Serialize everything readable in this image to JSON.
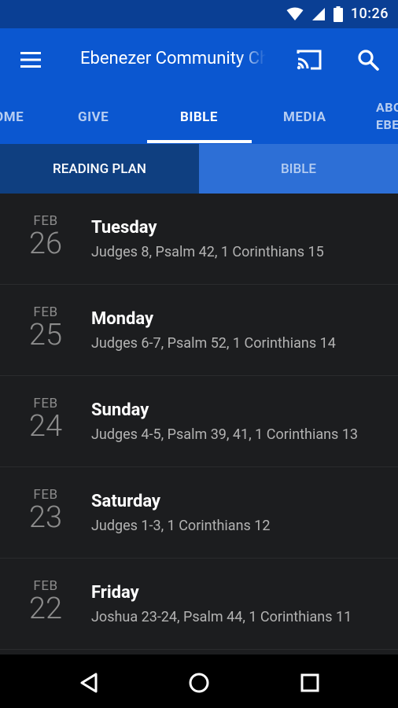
{
  "status_bar": {
    "time": "10:26"
  },
  "app_bar": {
    "title": "Ebenezer Community Church"
  },
  "tabs": [
    {
      "label": "HOME"
    },
    {
      "label": "GIVE"
    },
    {
      "label": "BIBLE"
    },
    {
      "label": "MEDIA"
    },
    {
      "label": "ABOUT EBENEZER"
    }
  ],
  "segments": [
    {
      "label": "READING PLAN"
    },
    {
      "label": "BIBLE"
    }
  ],
  "readings": [
    {
      "month": "FEB",
      "day": "26",
      "weekday": "Tuesday",
      "passages": "Judges 8, Psalm 42, 1 Corinthians 15"
    },
    {
      "month": "FEB",
      "day": "25",
      "weekday": "Monday",
      "passages": "Judges 6-7, Psalm 52, 1 Corinthians 14"
    },
    {
      "month": "FEB",
      "day": "24",
      "weekday": "Sunday",
      "passages": "Judges 4-5, Psalm 39, 41, 1 Corinthians 13"
    },
    {
      "month": "FEB",
      "day": "23",
      "weekday": "Saturday",
      "passages": "Judges 1-3, 1 Corinthians 12"
    },
    {
      "month": "FEB",
      "day": "22",
      "weekday": "Friday",
      "passages": "Joshua 23-24, Psalm 44, 1 Corinthians 11"
    }
  ],
  "colors": {
    "primary": "#0b57d0",
    "status_bar": "#0a3f94",
    "segment_active": "#0f3f80",
    "segment_inactive": "#2d6fd6",
    "list_bg": "#1c1d1f"
  },
  "icons": [
    "wifi-icon",
    "signal-icon",
    "battery-icon",
    "menu-icon",
    "cast-icon",
    "search-icon",
    "back-icon",
    "home-icon",
    "recents-icon"
  ]
}
